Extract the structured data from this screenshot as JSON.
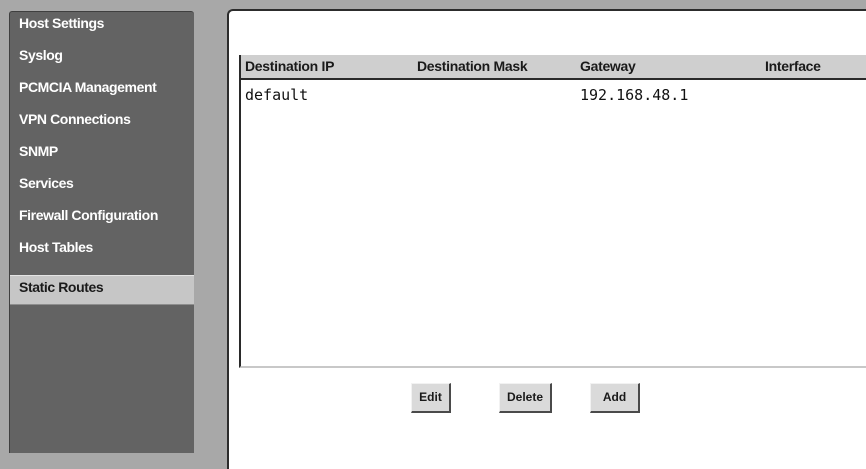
{
  "sidebar": {
    "items": [
      {
        "label": "Host Settings"
      },
      {
        "label": "Syslog"
      },
      {
        "label": "PCMCIA Management"
      },
      {
        "label": "VPN Connections"
      },
      {
        "label": "SNMP"
      },
      {
        "label": "Services"
      },
      {
        "label": "Firewall Configuration"
      },
      {
        "label": "Host Tables"
      },
      {
        "label": "Static Routes"
      }
    ],
    "active": "Static Routes"
  },
  "routes": {
    "columns": [
      "Destination IP",
      "Destination Mask",
      "Gateway",
      "Interface"
    ],
    "rows": [
      [
        "default",
        "",
        "192.168.48.1",
        ""
      ]
    ]
  },
  "buttons": {
    "edit": "Edit",
    "delete": "Delete",
    "add": "Add"
  }
}
